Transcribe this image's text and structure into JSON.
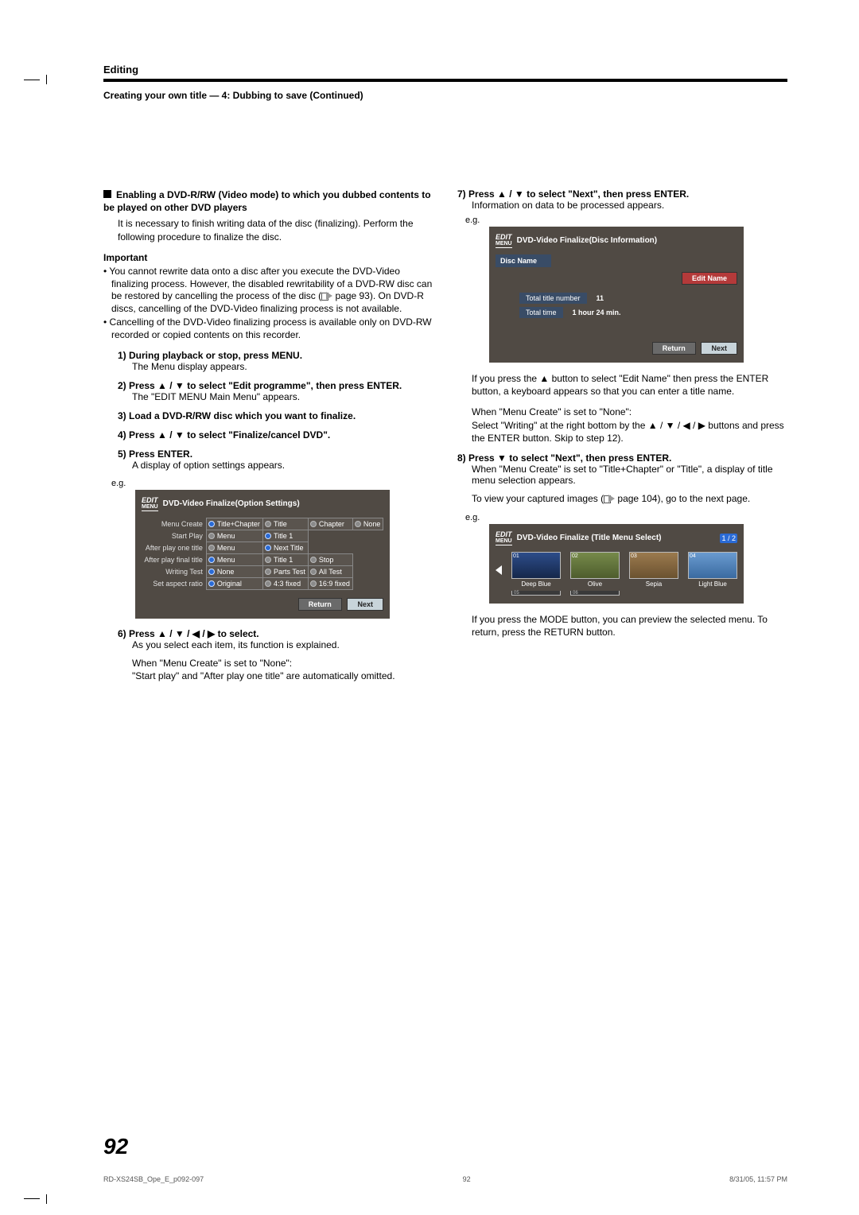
{
  "header": {
    "section": "Editing",
    "sub": "Creating your own title — 4: Dubbing to save (Continued)"
  },
  "left": {
    "h1": "Enabling a DVD-R/RW (Video mode) to which you dubbed contents to be played on other DVD players",
    "h1_body": "It is necessary to finish writing data of the disc (finalizing). Perform the following procedure to finalize the disc.",
    "important_label": "Important",
    "important_items": [
      "You cannot rewrite data onto a disc after you execute the DVD-Video finalizing process. However, the disabled rewritability of a DVD-RW disc can be restored by cancelling the process of the disc (      page 93). On DVD-R discs, cancelling of the DVD-Video finalizing process is not available.",
      "Cancelling of the DVD-Video finalizing process is available only on DVD-RW recorded or copied contents on this recorder."
    ],
    "steps": [
      {
        "n": "1)",
        "label": "During playback or stop, press MENU.",
        "body": "The Menu display appears."
      },
      {
        "n": "2)",
        "label": "Press ▲ / ▼ to select \"Edit programme\", then press ENTER.",
        "body": "The \"EDIT MENU Main Menu\" appears."
      },
      {
        "n": "3)",
        "label": "Load a DVD-R/RW disc which you want to finalize.",
        "body": ""
      },
      {
        "n": "4)",
        "label": "Press ▲ / ▼ to select \"Finalize/cancel DVD\".",
        "body": ""
      },
      {
        "n": "5)",
        "label": "Press ENTER.",
        "body": "A display of option settings appears."
      }
    ],
    "eg": "e.g.",
    "osd1": {
      "logo_top": "EDIT",
      "logo_bot": "MENU",
      "title": "DVD-Video Finalize(Option Settings)",
      "rows": [
        {
          "label": "Menu Create",
          "cells": [
            {
              "sel": "blue",
              "t": "Title+Chapter"
            },
            {
              "sel": "off",
              "t": "Title"
            },
            {
              "sel": "off",
              "t": "Chapter"
            },
            {
              "sel": "off",
              "t": "None"
            }
          ]
        },
        {
          "label": "Start Play",
          "cells": [
            {
              "sel": "off",
              "t": "Menu"
            },
            {
              "sel": "blue",
              "t": "Title 1"
            },
            {
              "t": ""
            },
            {
              "t": ""
            }
          ]
        },
        {
          "label": "After play one title",
          "cells": [
            {
              "sel": "off",
              "t": "Menu"
            },
            {
              "sel": "blue",
              "t": "Next Title"
            },
            {
              "t": ""
            },
            {
              "t": ""
            }
          ]
        },
        {
          "label": "After play final title",
          "cells": [
            {
              "sel": "blue",
              "t": "Menu"
            },
            {
              "sel": "off",
              "t": "Title 1"
            },
            {
              "sel": "off",
              "t": "Stop"
            },
            {
              "t": ""
            }
          ]
        },
        {
          "label": "Writing Test",
          "cells": [
            {
              "sel": "blue",
              "t": "None"
            },
            {
              "sel": "off",
              "t": "Parts Test"
            },
            {
              "sel": "off",
              "t": "All Test"
            },
            {
              "t": ""
            }
          ]
        },
        {
          "label": "Set aspect ratio",
          "cells": [
            {
              "sel": "blue",
              "t": "Original"
            },
            {
              "sel": "off",
              "t": "4:3 fixed"
            },
            {
              "sel": "off",
              "t": "16:9 fixed"
            },
            {
              "t": ""
            }
          ]
        }
      ],
      "return": "Return",
      "next": "Next"
    },
    "step6": {
      "n": "6)",
      "label": "Press ▲ / ▼ / ◀ / ▶ to select.",
      "body": "As you select each item, its function is explained."
    },
    "step6_extra": "When \"Menu Create\" is set to \"None\":\n\"Start play\" and \"After play one title\" are automatically omitted."
  },
  "right": {
    "step7": {
      "n": "7)",
      "label": "Press ▲ / ▼ to select \"Next\", then press ENTER.",
      "body": "Information on data to be processed appears."
    },
    "eg": "e.g.",
    "osd2": {
      "logo_top": "EDIT",
      "logo_bot": "MENU",
      "title": "DVD-Video Finalize(Disc Information)",
      "discname_label": "Disc Name",
      "edit": "Edit Name",
      "rows": [
        {
          "label": "Total title number",
          "val": "11"
        },
        {
          "label": "Total time",
          "val": "1 hour 24 min."
        }
      ],
      "return": "Return",
      "next": "Next"
    },
    "p_after_osd2": "If you press the ▲ button to select \"Edit Name\" then press the ENTER button, a keyboard appears so that you can enter a title name.",
    "p_menu_none": "When \"Menu Create\" is set to \"None\":\nSelect \"Writing\" at the right bottom by the ▲ / ▼ / ◀ / ▶ buttons and press the ENTER button. Skip to step 12).",
    "step8": {
      "n": "8)",
      "label": "Press ▼ to select \"Next\", then press ENTER.",
      "body": "When \"Menu Create\" is set to \"Title+Chapter\" or \"Title\", a display of title menu selection appears."
    },
    "p_images": "To view your captured images (      page 104), go to the next page.",
    "osd3": {
      "logo_top": "EDIT",
      "logo_bot": "MENU",
      "title": "DVD-Video Finalize (Title Menu Select)",
      "page": "1 / 2",
      "thumbs": [
        {
          "num": "01",
          "cap": "Deep Blue",
          "cls": "deepblue"
        },
        {
          "num": "02",
          "cap": "Olive",
          "cls": "olive"
        },
        {
          "num": "03",
          "cap": "Sepia",
          "cls": "sepia"
        },
        {
          "num": "04",
          "cap": "Light Blue",
          "cls": "lightblue"
        }
      ],
      "row2": [
        "05",
        "06"
      ]
    },
    "p_mode": "If you press the MODE button, you can preview the selected menu. To return, press the RETURN button."
  },
  "page_number": "92",
  "footer": {
    "left": "RD-XS24SB_Ope_E_p092-097",
    "mid": "92",
    "right": "8/31/05, 11:57 PM"
  }
}
